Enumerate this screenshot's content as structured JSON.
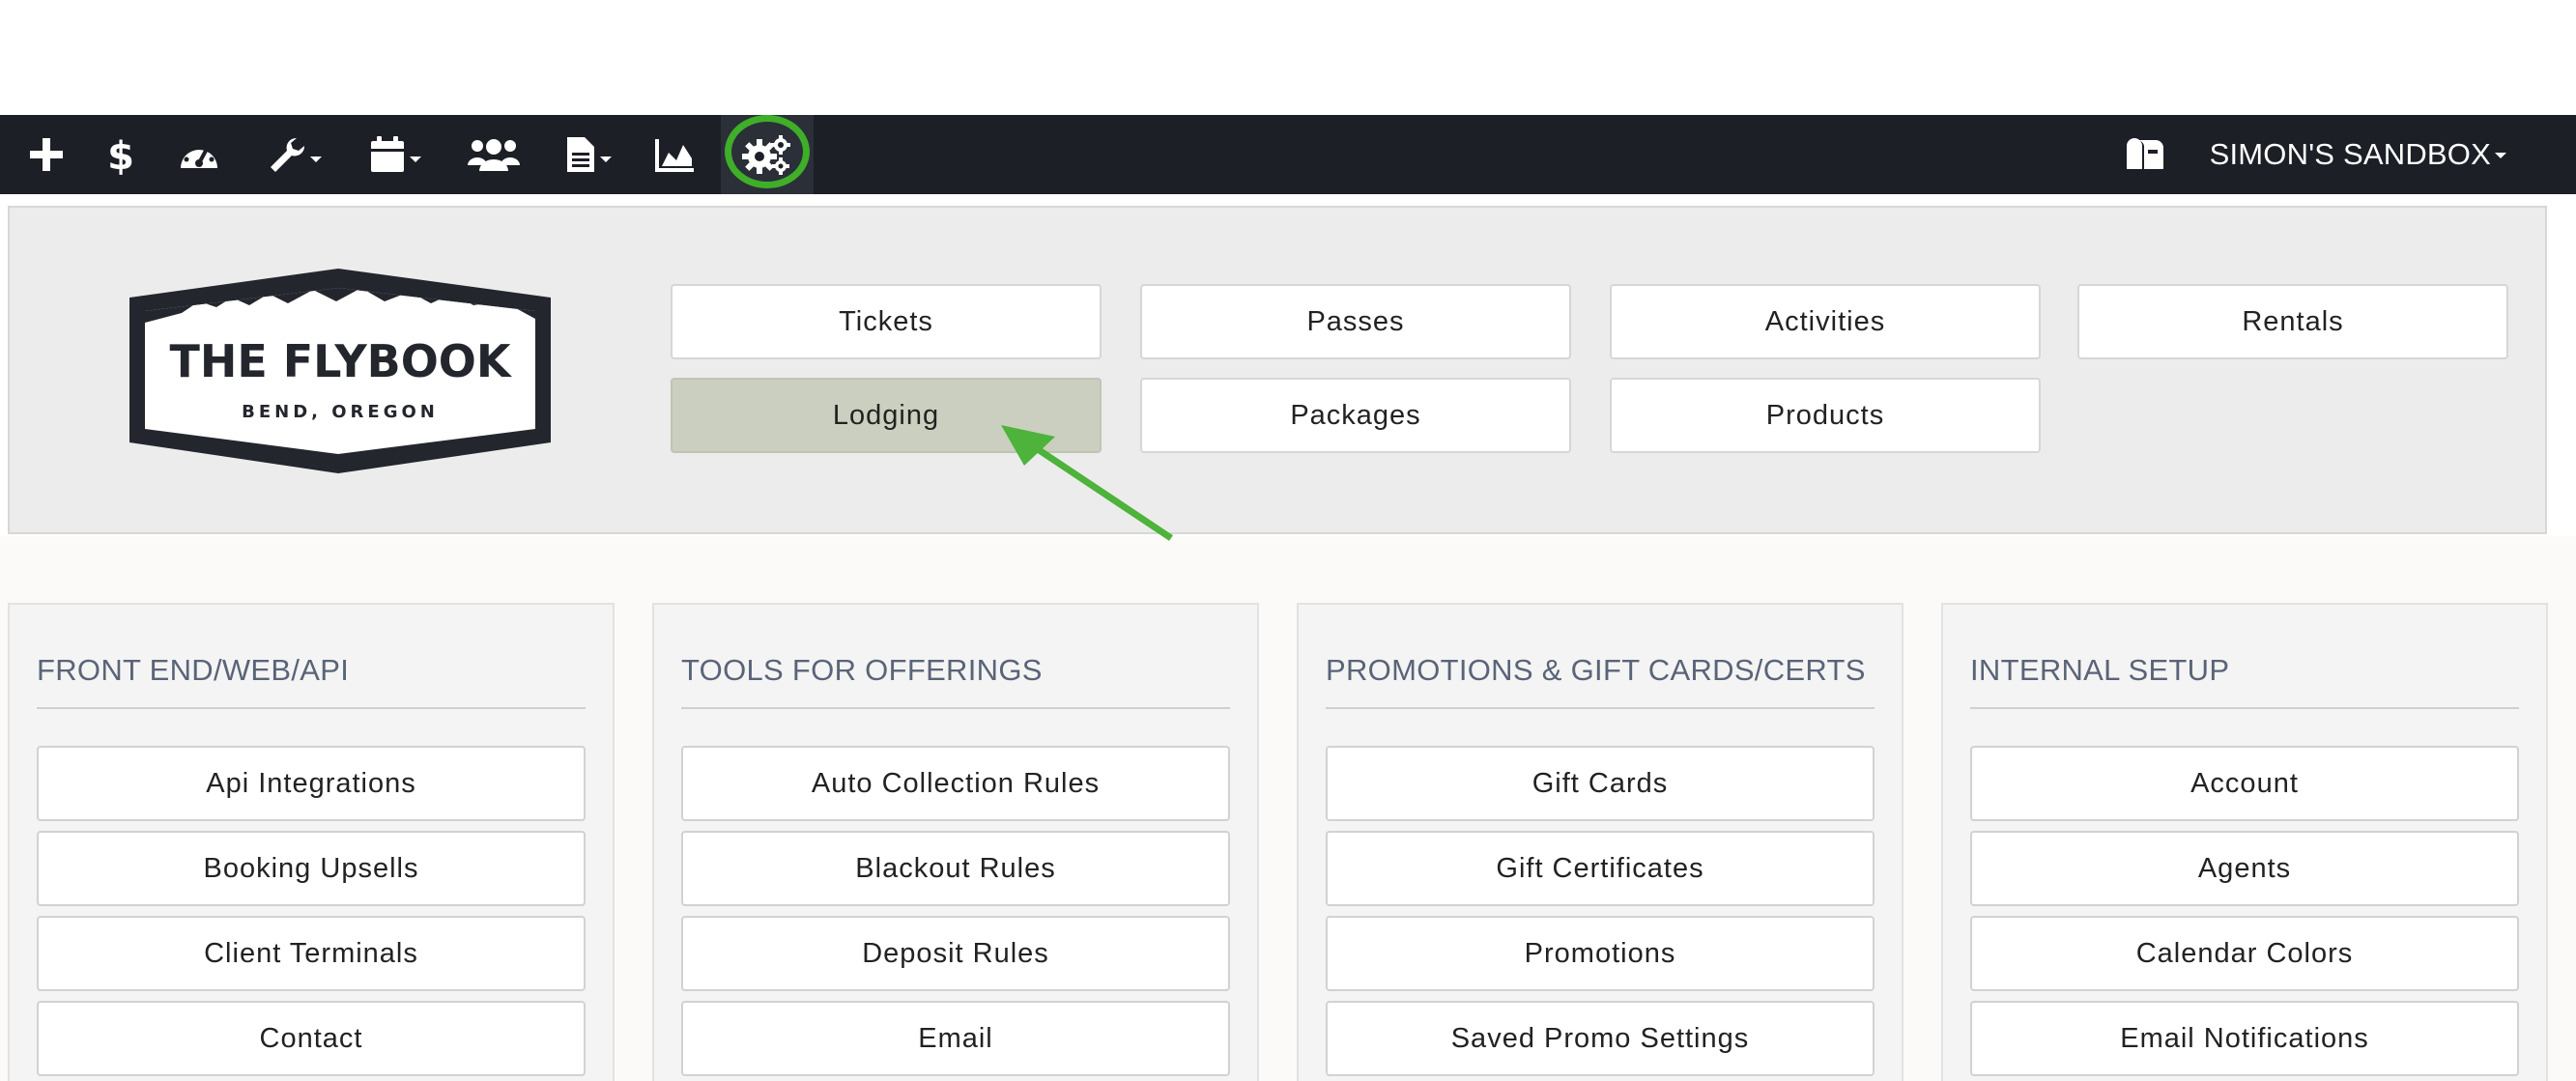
{
  "navbar": {
    "icons": [
      {
        "name": "add-icon"
      },
      {
        "name": "dollar-icon"
      },
      {
        "name": "dashboard-icon"
      },
      {
        "name": "tools-icon"
      },
      {
        "name": "calendar-icon"
      },
      {
        "name": "users-icon"
      },
      {
        "name": "document-icon"
      },
      {
        "name": "reports-icon"
      },
      {
        "name": "settings-icon"
      }
    ],
    "account_label": "SIMON'S SANDBOX",
    "bg_color": "#1c1f26",
    "highlight_color": "#3fae29"
  },
  "logo": {
    "name": "THE FLYBOOK",
    "location": "BEND, OREGON"
  },
  "offerings": {
    "row1": [
      "Tickets",
      "Passes",
      "Activities",
      "Rentals"
    ],
    "row2": [
      "Lodging",
      "Packages",
      "Products"
    ],
    "active": "Lodging"
  },
  "sections": [
    {
      "title": "FRONT END/WEB/API",
      "items": [
        "Api Integrations",
        "Booking Upsells",
        "Client Terminals",
        "Contact"
      ]
    },
    {
      "title": "TOOLS FOR OFFERINGS",
      "items": [
        "Auto Collection Rules",
        "Blackout Rules",
        "Deposit Rules",
        "Email"
      ]
    },
    {
      "title": "PROMOTIONS & GIFT CARDS/CERTS",
      "items": [
        "Gift Cards",
        "Gift Certificates",
        "Promotions",
        "Saved Promo Settings"
      ]
    },
    {
      "title": "INTERNAL SETUP",
      "items": [
        "Account",
        "Agents",
        "Calendar Colors",
        "Email Notifications"
      ]
    }
  ]
}
